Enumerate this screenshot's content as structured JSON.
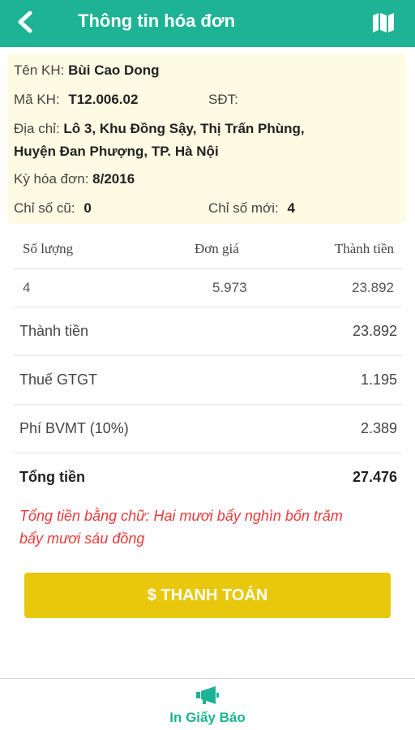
{
  "header": {
    "title": "Thông tin hóa đơn",
    "back_icon": "chevron-left-icon",
    "map_icon": "map-icon",
    "color": "#1db394"
  },
  "customer": {
    "name_label": "Tên KH:",
    "name": "Bùi Cao Dong",
    "code_label": "Mã KH:",
    "code": "T12.006.02",
    "phone_label": "SĐT:",
    "phone": "",
    "address_label": "Địa chỉ:",
    "address_line1": "Lô 3, Khu Đồng Sậy, Thị Trấn Phùng,",
    "address_line2": "Huyện Đan Phượng, TP. Hà Nội",
    "period_label": "Kỳ hóa đơn:",
    "period": "8/2016",
    "old_index_label": "Chỉ số cũ:",
    "old_index": "0",
    "new_index_label": "Chỉ số mới:",
    "new_index": "4"
  },
  "table": {
    "headers": [
      "Số lượng",
      "Đơn giá",
      "Thành tiền"
    ],
    "rows": [
      {
        "quantity": "4",
        "unit_price": "5.973",
        "amount": "23.892"
      }
    ]
  },
  "summary": {
    "subtotal_label": "Thành tiền",
    "subtotal": "23.892",
    "vat_label": "Thuế GTGT",
    "vat": "1.195",
    "env_fee_label": "Phí BVMT (10%)",
    "env_fee": "2.389",
    "total_label": "Tổng tiền",
    "total": "27.476"
  },
  "amount_in_words": {
    "line1": "Tổng tiền bằng chữ: Hai mươi bẩy nghìn bốn trăm",
    "line2": "bẩy mươi sáu đồng"
  },
  "pay_button": {
    "label": "$ THANH TOÁN",
    "color": "#e8c80c"
  },
  "bottom_nav": {
    "label": "In Giấy Báo",
    "icon": "megaphone-icon"
  }
}
